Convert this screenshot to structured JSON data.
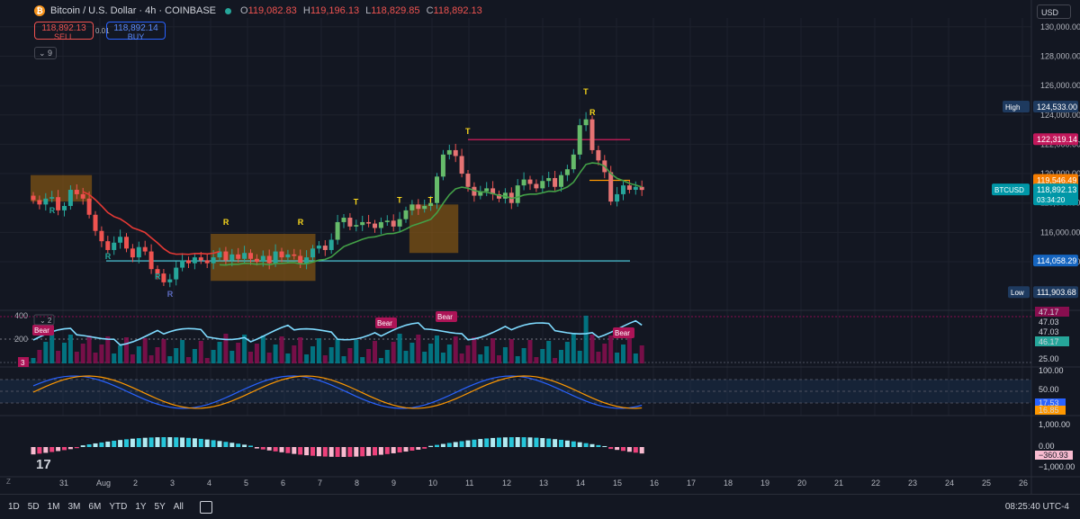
{
  "header": {
    "symbol": "Bitcoin / U.S. Dollar · 4h · COINBASE",
    "o_label": "O",
    "o_value": "119,082.83",
    "h_label": "H",
    "h_value": "119,196.13",
    "l_label": "L",
    "l_value": "118,829.85",
    "c_label": "C",
    "c_value": "118,892.13"
  },
  "trade": {
    "sell_price": "118,892.13",
    "sell_label": "SELL",
    "buy_price": "118,892.14",
    "buy_label": "BUY",
    "qty": "0.01"
  },
  "indicator_count": "9",
  "currency": "USD",
  "chart_data": {
    "type": "candlestick",
    "price_axis": {
      "ylim": [
        111000,
        130600
      ],
      "ticks": [
        "130,000.00",
        "128,000.00",
        "126,000.00",
        "124,000.00",
        "122,000.00",
        "120,000.00",
        "118,000.00",
        "116,000.00",
        "114,000.00"
      ]
    },
    "price_labels": [
      {
        "label": "High",
        "value": "124,533.00",
        "price": 124533
      },
      {
        "label": "",
        "value": "122,319.14",
        "price": 122319
      },
      {
        "label": "",
        "value": "119,546.49",
        "price": 119546
      },
      {
        "label": "BTCUSD",
        "value": "118,892.13",
        "price": 118892,
        "sub": "03:34:20"
      },
      {
        "label": "",
        "value": "114,058.29",
        "price": 114058
      },
      {
        "label": "Low",
        "value": "111,903.68",
        "price": 111904
      }
    ],
    "x_ticks": [
      "31",
      "Aug",
      "2",
      "3",
      "4",
      "5",
      "6",
      "7",
      "8",
      "9",
      "10",
      "11",
      "12",
      "13",
      "14",
      "15",
      "16",
      "17",
      "18",
      "19",
      "20",
      "21",
      "22",
      "23",
      "24",
      "25",
      "26"
    ],
    "close": [
      118200,
      117900,
      118300,
      118400,
      117500,
      117800,
      118900,
      118600,
      118300,
      117200,
      116100,
      115400,
      114800,
      115300,
      115700,
      114900,
      114300,
      115000,
      114700,
      113500,
      113200,
      112600,
      112800,
      113600,
      114100,
      113900,
      114300,
      114100,
      113900,
      114300,
      114700,
      114100,
      114500,
      114200,
      114600,
      114200,
      114000,
      114400,
      113900,
      114700,
      114300,
      114500,
      114400,
      113900,
      114300,
      114900,
      115100,
      114800,
      115500,
      116700,
      117000,
      116400,
      116500,
      116700,
      116600,
      116300,
      116700,
      116800,
      116400,
      116900,
      117500,
      117900,
      117600,
      117800,
      118000,
      119800,
      121300,
      121600,
      121200,
      120000,
      119100,
      118500,
      118800,
      119000,
      118600,
      118300,
      118700,
      118000,
      119200,
      119600,
      119300,
      119000,
      119500,
      119700,
      119100,
      119900,
      120300,
      121300,
      123300,
      123700,
      121600,
      120900,
      120100,
      118100,
      118600,
      119200,
      118900,
      119100,
      118892
    ],
    "levels": [
      {
        "price": 114058,
        "color": "#4dd0e1"
      },
      {
        "price": 122319,
        "color": "#e91e63"
      },
      {
        "price": 119546,
        "color": "#ff9800"
      }
    ],
    "signals": [
      "R",
      "R",
      "R",
      "R",
      "R",
      "R",
      "T",
      "T",
      "T",
      "T",
      "T",
      "R"
    ],
    "volume_panel": {
      "pane_label": "2",
      "axis_left": [
        "400",
        "200"
      ],
      "axis_right": [
        "47.17",
        "47.03",
        "47.03",
        "46.17",
        "25.00"
      ],
      "tags": [
        "Bear",
        "Bear",
        "Bear",
        "Bear"
      ],
      "pane_number": "3"
    },
    "stoch_panel": {
      "axis_right": [
        "100.00",
        "50.00",
        "17.53",
        "16.85"
      ]
    },
    "macd_panel": {
      "axis_right": [
        "1,000.00",
        "0.00",
        "−360.93",
        "−1,000.00"
      ]
    }
  },
  "bottom_bar": {
    "ranges": [
      "1D",
      "5D",
      "1M",
      "3M",
      "6M",
      "YTD",
      "1Y",
      "5Y",
      "All"
    ],
    "clock": "08:25:40 UTC-4",
    "logo": "17",
    "z": "Z"
  }
}
